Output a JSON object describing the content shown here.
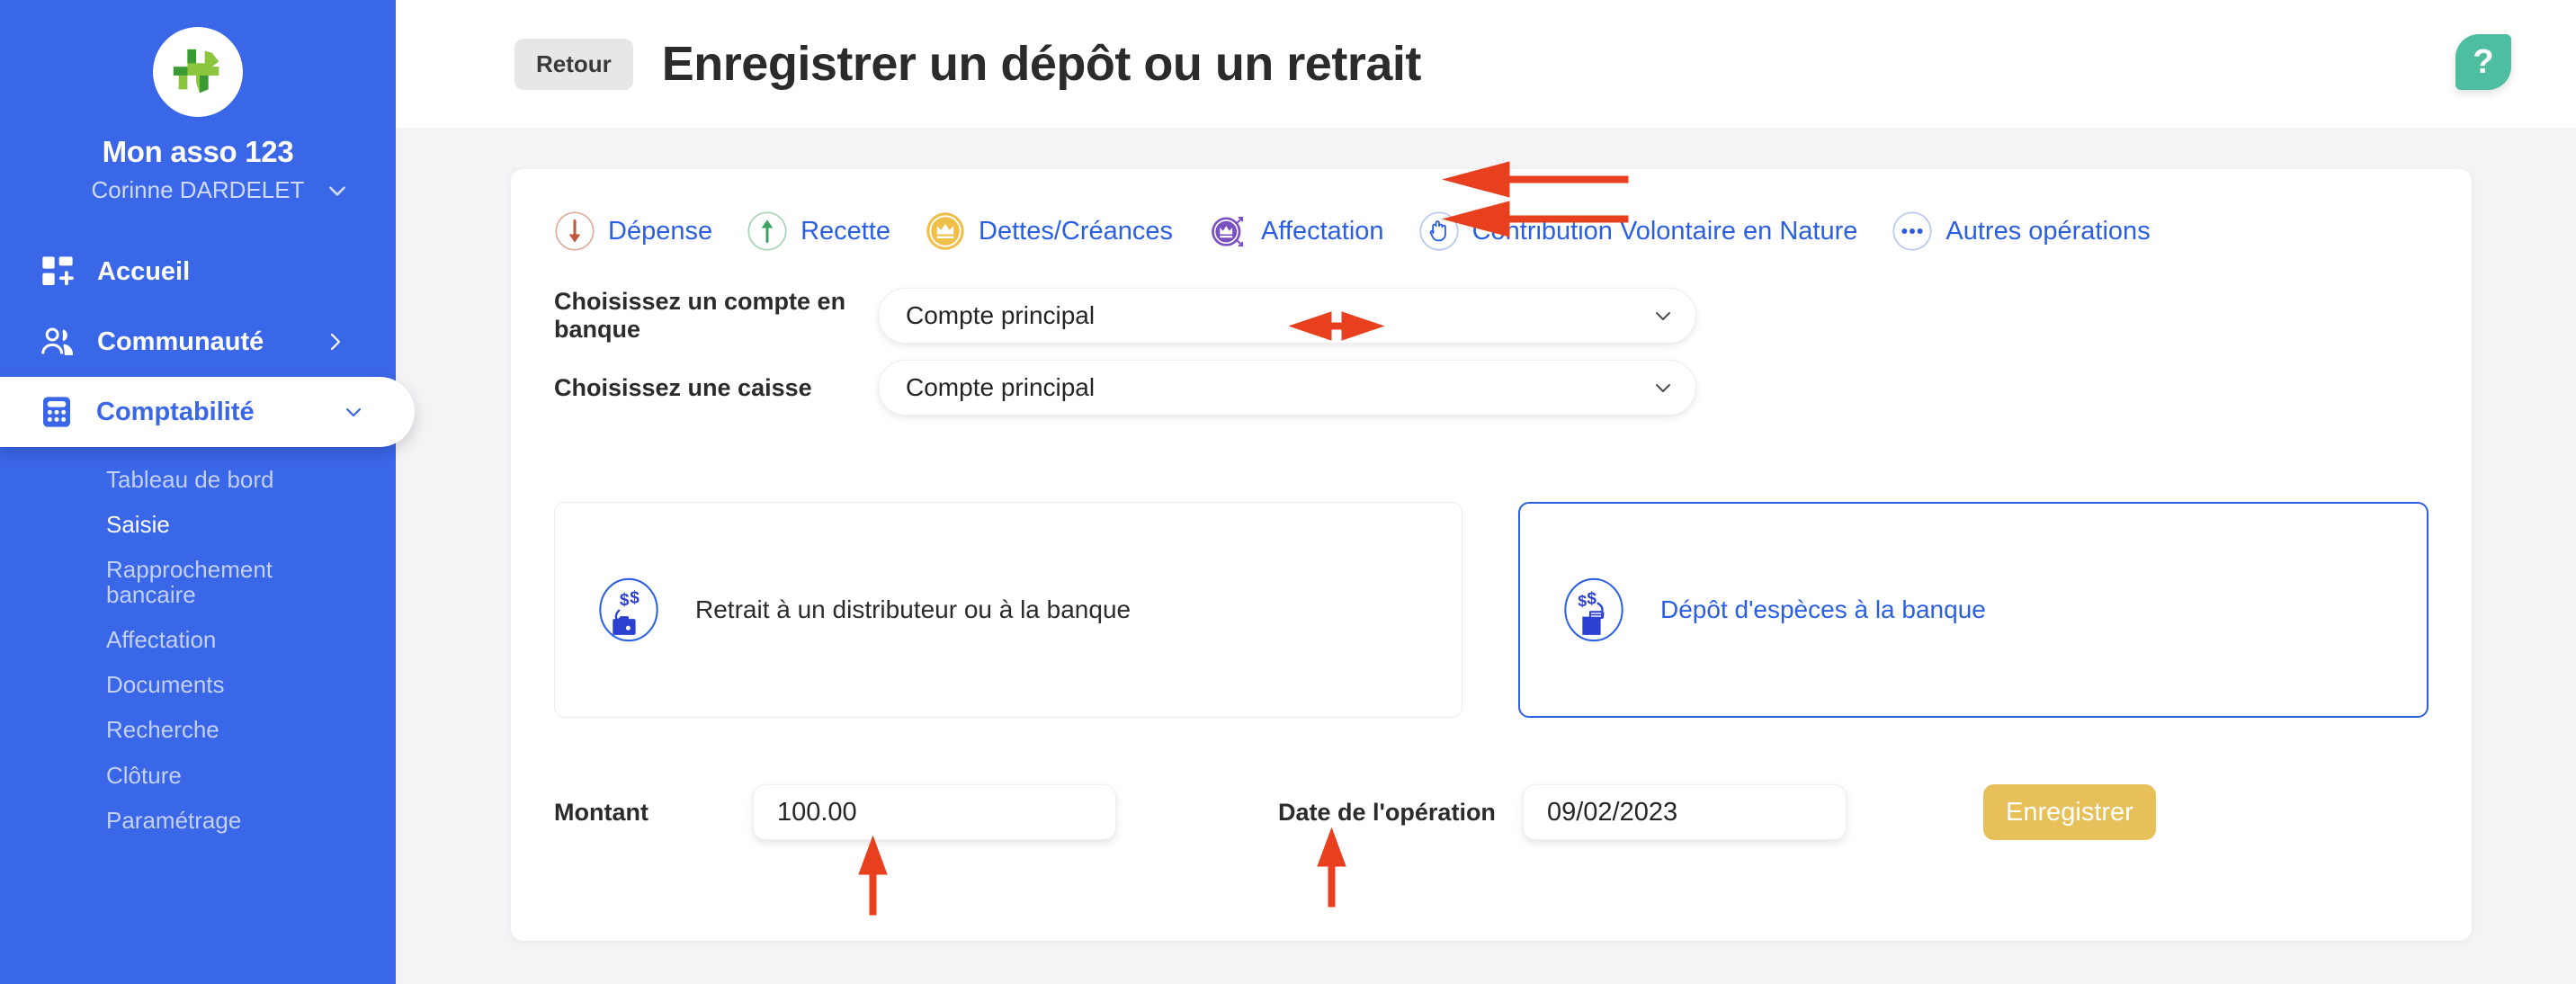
{
  "sidebar": {
    "brand_name": "Mon asso 123",
    "user_name": "Corinne DARDELET",
    "items": [
      {
        "label": "Accueil",
        "icon": "dashboard-grid-icon",
        "has_arrow": false,
        "active": false
      },
      {
        "label": "Communauté",
        "icon": "people-icon",
        "has_arrow": true,
        "active": false
      },
      {
        "label": "Comptabilité",
        "icon": "calculator-icon",
        "has_arrow": true,
        "active": true
      }
    ],
    "subitems": [
      {
        "label": "Tableau de bord",
        "current": false
      },
      {
        "label": "Saisie",
        "current": true
      },
      {
        "label": "Rapprochement bancaire",
        "current": false
      },
      {
        "label": "Affectation",
        "current": false
      },
      {
        "label": "Documents",
        "current": false
      },
      {
        "label": "Recherche",
        "current": false
      },
      {
        "label": "Clôture",
        "current": false
      },
      {
        "label": "Paramétrage",
        "current": false
      }
    ]
  },
  "topbar": {
    "back_label": "Retour",
    "page_title": "Enregistrer un dépôt ou un retrait",
    "help_label": "?"
  },
  "tabs": [
    {
      "label": "Dépense",
      "icon": "arrow-down-circle-icon",
      "color": "#c0563a"
    },
    {
      "label": "Recette",
      "icon": "arrow-up-circle-icon",
      "color": "#3aa35f"
    },
    {
      "label": "Dettes/Créances",
      "icon": "crown-coin-icon",
      "color": "#eec04a"
    },
    {
      "label": "Affectation",
      "icon": "crown-allocation-icon",
      "color": "#7a4fbf"
    },
    {
      "label": "Contribution Volontaire en Nature",
      "icon": "hand-icon",
      "color": "#2b5fe3"
    },
    {
      "label": "Autres opérations",
      "icon": "ellipsis-circle-icon",
      "color": "#2b5fe3"
    }
  ],
  "form": {
    "bank_account_label": "Choisissez un compte en banque",
    "bank_account_value": "Compte principal",
    "cash_register_label": "Choisissez une caisse",
    "cash_register_value": "Compte principal",
    "amount_label": "Montant",
    "amount_value": "100.00",
    "date_label": "Date de l'opération",
    "date_value": "09/02/2023",
    "save_label": "Enregistrer"
  },
  "choices": [
    {
      "label": "Retrait à un distributeur ou à la banque",
      "icon": "cash-withdrawal-icon",
      "selected": false
    },
    {
      "label": "Dépôt d'espèces à la banque",
      "icon": "cash-deposit-icon",
      "selected": true
    }
  ],
  "colors": {
    "sidebar_blue": "#3a66e8",
    "accent_blue": "#2b5fe3",
    "annotation_red": "#e8401f",
    "save_yellow": "#e8c05a",
    "help_green": "#4dbfa0"
  }
}
